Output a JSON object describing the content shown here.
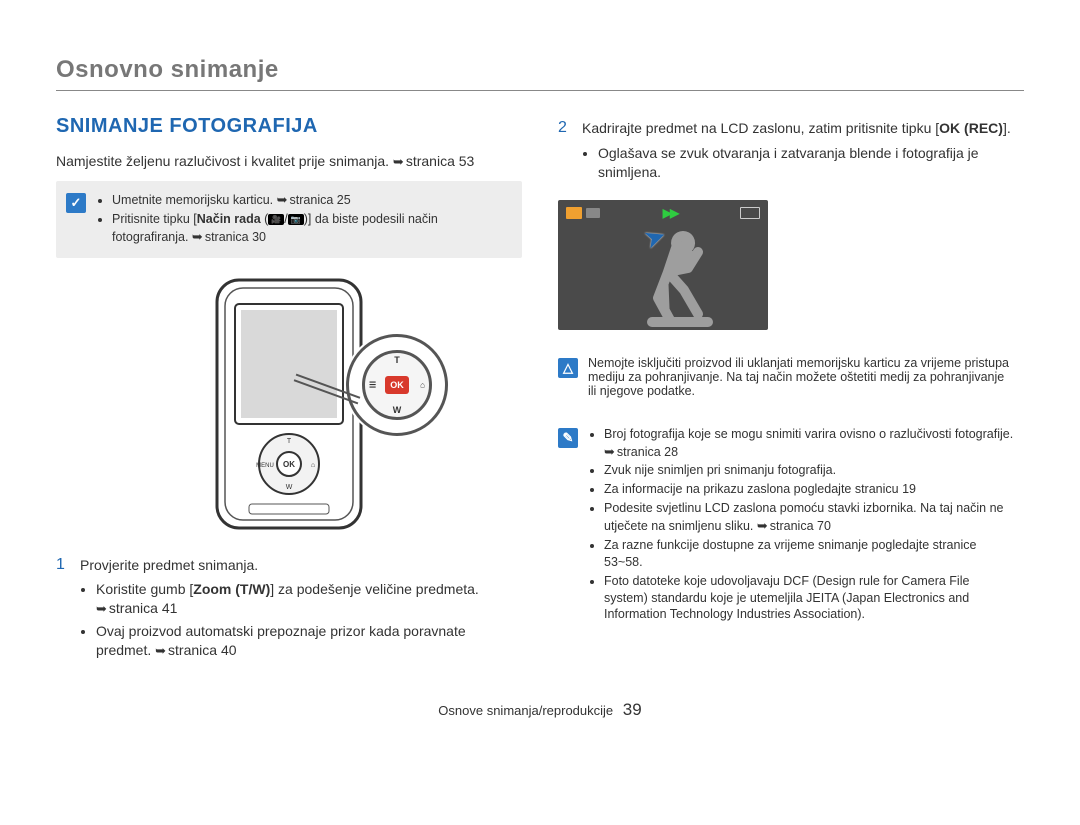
{
  "header": {
    "title": "Osnovno snimanje"
  },
  "left": {
    "section_title": "SNIMANJE FOTOGRAFIJA",
    "intro_text": "Namjestite željenu razlučivost i kvalitet prije snimanja. ",
    "intro_ref": "stranica 53",
    "note1": {
      "items": [
        {
          "pre": "Umetnite memorijsku karticu. ",
          "ref": "stranica 25"
        },
        {
          "pre": "Pritisnite tipku [",
          "bold": "Način rada",
          "mid": " (",
          "icon1": "🎥",
          "slash": "/",
          "icon2": "📷",
          "post": ")] da biste podesili način fotografiranja. ",
          "ref": "stranica 30"
        }
      ]
    },
    "ok_label": "OK",
    "step1": {
      "num": "1",
      "text": "Provjerite predmet snimanja.",
      "bullets": [
        {
          "pre": "Koristite gumb [",
          "bold": "Zoom (T/W)",
          "mid": "] za podešenje veličine predmeta. ",
          "ref": "stranica 41"
        },
        {
          "pre": "Ovaj proizvod automatski prepoznaje prizor kada poravnate predmet. ",
          "ref": "stranica 40"
        }
      ]
    }
  },
  "right": {
    "step2": {
      "num": "2",
      "pre": "Kadrirajte predmet na LCD zaslonu, zatim pritisnite tipku [",
      "bold": "OK (REC)",
      "post": "].",
      "bullets": [
        {
          "text": "Oglašava se zvuk otvaranja i zatvaranja blende i fotografija je snimljena."
        }
      ]
    },
    "screen": {
      "ff": "▶▶"
    },
    "warn": {
      "text": "Nemojte isključiti proizvod ili uklanjati memorijsku karticu za vrijeme pristupa mediju za pohranjivanje. Na taj način možete oštetiti medij za pohranjivanje ili njegove podatke."
    },
    "info": {
      "items": [
        {
          "pre": "Broj fotografija koje se mogu snimiti varira ovisno o razlučivosti fotografije. ",
          "ref": "stranica 28"
        },
        {
          "pre": "Zvuk nije snimljen pri snimanju fotografija."
        },
        {
          "pre": "Za informacije na prikazu zaslona pogledajte stranicu 19"
        },
        {
          "pre": "Podesite svjetlinu LCD zaslona pomoću stavki izbornika. Na taj način ne utječete na snimljenu sliku. ",
          "ref": "stranica 70"
        },
        {
          "pre": "Za razne funkcije dostupne za vrijeme snimanje pogledajte stranice 53~58."
        },
        {
          "pre": "Foto datoteke koje udovoljavaju DCF (Design rule for Camera File system) standardu koje je utemeljila JEITA (Japan Electronics and Information Technology Industries Association)."
        }
      ]
    }
  },
  "footer": {
    "text": "Osnove snimanja/reprodukcije",
    "page": "39"
  }
}
